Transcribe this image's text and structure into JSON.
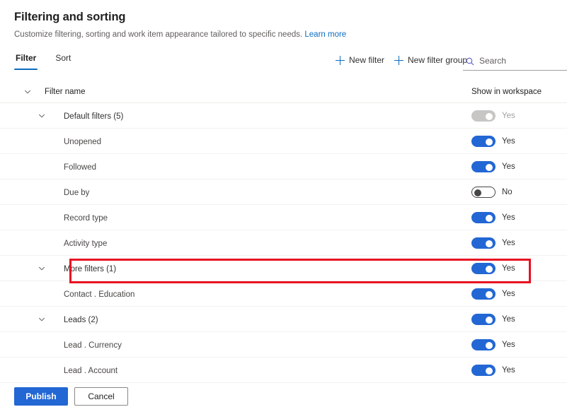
{
  "header": {
    "title": "Filtering and sorting",
    "subtitle": "Customize filtering, sorting and work item appearance tailored to specific needs.",
    "learn_more": "Learn more"
  },
  "tabs": [
    {
      "label": "Filter",
      "active": true
    },
    {
      "label": "Sort",
      "active": false
    }
  ],
  "toolbar": {
    "new_filter": "New filter",
    "new_filter_group": "New filter group"
  },
  "search": {
    "placeholder": "Search",
    "value": ""
  },
  "table": {
    "columns": {
      "name": "Filter name",
      "toggle": "Show in workspace"
    },
    "rows": [
      {
        "label": "Default filters (5)",
        "type": "group",
        "toggle_state": "disabled",
        "toggle_label": "Yes",
        "highlighted": false
      },
      {
        "label": "Unopened",
        "type": "child",
        "toggle_state": "on",
        "toggle_label": "Yes",
        "highlighted": false
      },
      {
        "label": "Followed",
        "type": "child",
        "toggle_state": "on",
        "toggle_label": "Yes",
        "highlighted": false
      },
      {
        "label": "Due by",
        "type": "child",
        "toggle_state": "off",
        "toggle_label": "No",
        "highlighted": true
      },
      {
        "label": "Record type",
        "type": "child",
        "toggle_state": "on",
        "toggle_label": "Yes",
        "highlighted": false
      },
      {
        "label": "Activity type",
        "type": "child",
        "toggle_state": "on",
        "toggle_label": "Yes",
        "highlighted": false
      },
      {
        "label": "More filters (1)",
        "type": "group",
        "toggle_state": "on",
        "toggle_label": "Yes",
        "highlighted": false
      },
      {
        "label": "Contact . Education",
        "type": "child",
        "toggle_state": "on",
        "toggle_label": "Yes",
        "highlighted": false
      },
      {
        "label": "Leads (2)",
        "type": "group",
        "toggle_state": "on",
        "toggle_label": "Yes",
        "highlighted": false
      },
      {
        "label": "Lead . Currency",
        "type": "child",
        "toggle_state": "on",
        "toggle_label": "Yes",
        "highlighted": false
      },
      {
        "label": "Lead . Account",
        "type": "child",
        "toggle_state": "on",
        "toggle_label": "Yes",
        "highlighted": false
      }
    ]
  },
  "footer": {
    "publish": "Publish",
    "cancel": "Cancel"
  },
  "colors": {
    "accent": "#2267d4",
    "link": "#0f6cbd",
    "highlight": "#e81123",
    "toggle_disabled": "#c8c6c4"
  }
}
